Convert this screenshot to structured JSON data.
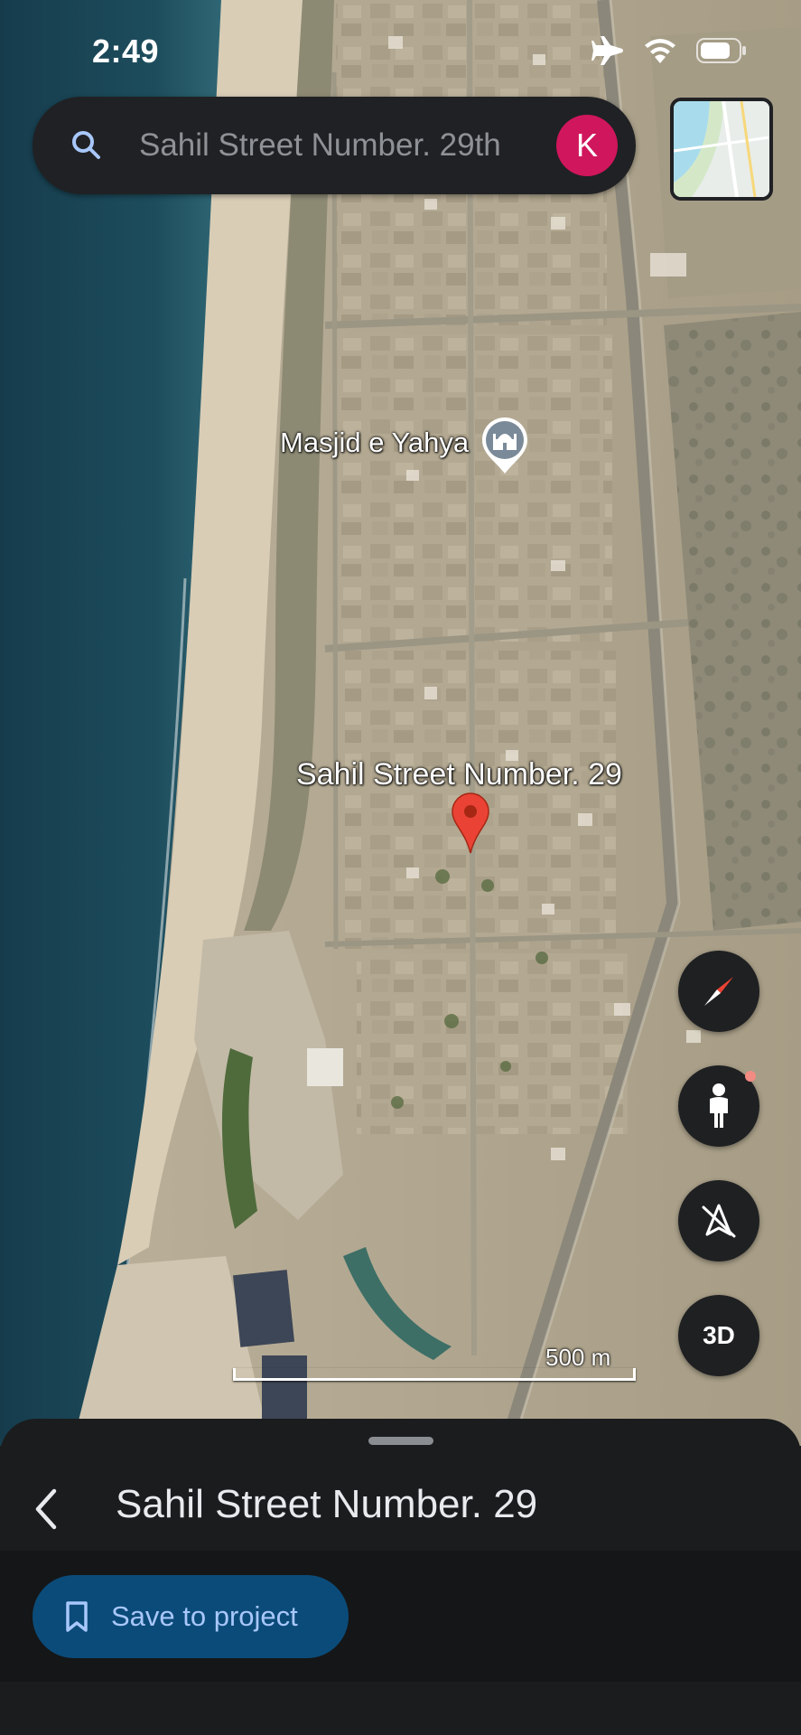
{
  "status_bar": {
    "time": "2:49"
  },
  "search": {
    "placeholder": "Sahil Street Number. 29th",
    "avatar_letter": "K"
  },
  "map": {
    "poi_label": "Masjid e Yahya",
    "pin_label": "Sahil Street Number. 29",
    "scale_label": "500 m"
  },
  "controls": {
    "three_d_label": "3D"
  },
  "sheet": {
    "title": "Sahil Street Number. 29",
    "save_button_label": "Save to project"
  },
  "colors": {
    "avatar": "#d0165c",
    "pin": "#ea4335",
    "save_button": "#0b4b79",
    "save_text": "#a8c7fa",
    "poi": "#7a8a99"
  }
}
